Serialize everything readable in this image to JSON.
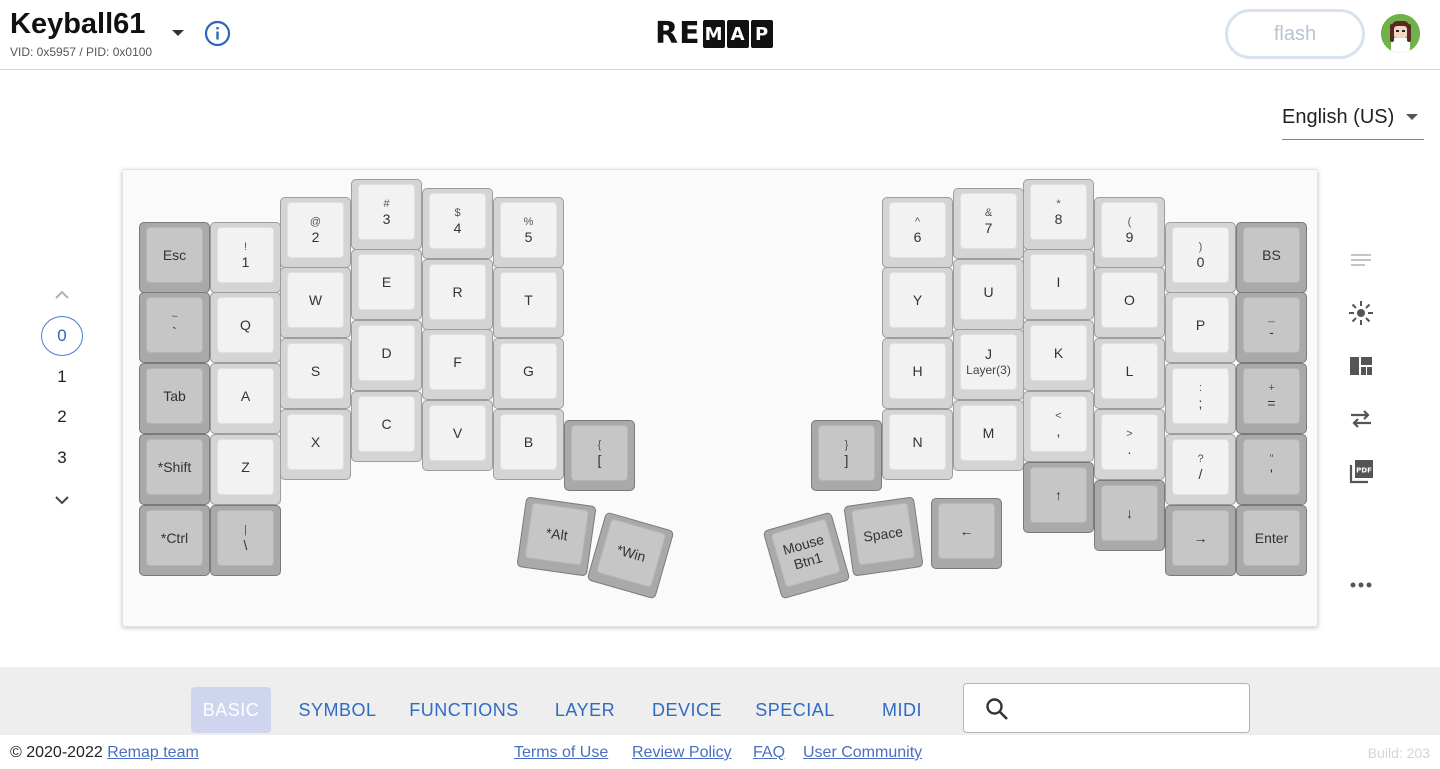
{
  "header": {
    "keyboard_name": "Keyball61",
    "ids": "VID: 0x5957 / PID: 0x0100",
    "logo_plain": "RE",
    "logo_boxed": [
      "M",
      "A",
      "P"
    ],
    "flash_label": "flash",
    "info_icon": "info-icon",
    "dropdown_icon": "caret-down-icon"
  },
  "language": {
    "selected": "English (US)"
  },
  "layers": {
    "items": [
      "0",
      "1",
      "2",
      "3"
    ],
    "active": "0"
  },
  "keys": [
    {
      "top": "",
      "main": "Esc",
      "sub": "",
      "tone": "dark"
    },
    {
      "top": "!",
      "main": "1",
      "sub": "",
      "tone": "light"
    },
    {
      "top": "@",
      "main": "2",
      "sub": "",
      "tone": "light"
    },
    {
      "top": "#",
      "main": "3",
      "sub": "",
      "tone": "light"
    },
    {
      "top": "$",
      "main": "4",
      "sub": "",
      "tone": "light"
    },
    {
      "top": "%",
      "main": "5",
      "sub": "",
      "tone": "light"
    },
    {
      "top": "~",
      "main": "`",
      "sub": "",
      "tone": "dark"
    },
    {
      "top": "",
      "main": "Q",
      "sub": "",
      "tone": "light"
    },
    {
      "top": "",
      "main": "W",
      "sub": "",
      "tone": "light"
    },
    {
      "top": "",
      "main": "E",
      "sub": "",
      "tone": "light"
    },
    {
      "top": "",
      "main": "R",
      "sub": "",
      "tone": "light"
    },
    {
      "top": "",
      "main": "T",
      "sub": "",
      "tone": "light"
    },
    {
      "top": "",
      "main": "Tab",
      "sub": "",
      "tone": "dark"
    },
    {
      "top": "",
      "main": "A",
      "sub": "",
      "tone": "light"
    },
    {
      "top": "",
      "main": "S",
      "sub": "",
      "tone": "light"
    },
    {
      "top": "",
      "main": "D",
      "sub": "",
      "tone": "light"
    },
    {
      "top": "",
      "main": "F",
      "sub": "",
      "tone": "light"
    },
    {
      "top": "",
      "main": "G",
      "sub": "",
      "tone": "light"
    },
    {
      "top": "",
      "main": "*Shift",
      "sub": "",
      "tone": "dark"
    },
    {
      "top": "",
      "main": "Z",
      "sub": "",
      "tone": "light"
    },
    {
      "top": "",
      "main": "X",
      "sub": "",
      "tone": "light"
    },
    {
      "top": "",
      "main": "C",
      "sub": "",
      "tone": "light"
    },
    {
      "top": "",
      "main": "V",
      "sub": "",
      "tone": "light"
    },
    {
      "top": "",
      "main": "B",
      "sub": "",
      "tone": "light"
    },
    {
      "top": "{",
      "main": "[",
      "sub": "",
      "tone": "dark"
    },
    {
      "top": "",
      "main": "*Ctrl",
      "sub": "",
      "tone": "dark"
    },
    {
      "top": "|",
      "main": "\\",
      "sub": "",
      "tone": "dark"
    },
    {
      "top": "",
      "main": "*Alt",
      "sub": "",
      "tone": "dark"
    },
    {
      "top": "",
      "main": "*Win",
      "sub": "",
      "tone": "dark"
    },
    {
      "top": "^",
      "main": "6",
      "sub": "",
      "tone": "light"
    },
    {
      "top": "&",
      "main": "7",
      "sub": "",
      "tone": "light"
    },
    {
      "top": "*",
      "main": "8",
      "sub": "",
      "tone": "light"
    },
    {
      "top": "(",
      "main": "9",
      "sub": "",
      "tone": "light"
    },
    {
      "top": ")",
      "main": "0",
      "sub": "",
      "tone": "light"
    },
    {
      "top": "",
      "main": "BS",
      "sub": "",
      "tone": "dark"
    },
    {
      "top": "",
      "main": "Y",
      "sub": "",
      "tone": "light"
    },
    {
      "top": "",
      "main": "U",
      "sub": "",
      "tone": "light"
    },
    {
      "top": "",
      "main": "I",
      "sub": "",
      "tone": "light"
    },
    {
      "top": "",
      "main": "O",
      "sub": "",
      "tone": "light"
    },
    {
      "top": "",
      "main": "P",
      "sub": "",
      "tone": "light"
    },
    {
      "top": "_",
      "main": "-",
      "sub": "",
      "tone": "dark"
    },
    {
      "top": "",
      "main": "H",
      "sub": "",
      "tone": "light"
    },
    {
      "top": "",
      "main": "J",
      "sub": "Layer(3)",
      "tone": "light"
    },
    {
      "top": "",
      "main": "K",
      "sub": "",
      "tone": "light"
    },
    {
      "top": "",
      "main": "L",
      "sub": "",
      "tone": "light"
    },
    {
      "top": ":",
      "main": ";",
      "sub": "",
      "tone": "light"
    },
    {
      "top": "+",
      "main": "=",
      "sub": "",
      "tone": "dark"
    },
    {
      "top": "}",
      "main": "]",
      "sub": "",
      "tone": "dark"
    },
    {
      "top": "",
      "main": "N",
      "sub": "",
      "tone": "light"
    },
    {
      "top": "",
      "main": "M",
      "sub": "",
      "tone": "light"
    },
    {
      "top": "<",
      "main": ",",
      "sub": "",
      "tone": "light"
    },
    {
      "top": ">",
      "main": ".",
      "sub": "",
      "tone": "light"
    },
    {
      "top": "?",
      "main": "/",
      "sub": "",
      "tone": "light"
    },
    {
      "top": "\"",
      "main": "'",
      "sub": "",
      "tone": "dark"
    },
    {
      "top": "",
      "main": "Mouse Btn1",
      "sub": "",
      "tone": "dark"
    },
    {
      "top": "",
      "main": "Space",
      "sub": "",
      "tone": "dark"
    },
    {
      "top": "",
      "main": "←",
      "sub": "",
      "tone": "dark"
    },
    {
      "top": "",
      "main": "↑",
      "sub": "",
      "tone": "dark"
    },
    {
      "top": "",
      "main": "↓",
      "sub": "",
      "tone": "dark"
    },
    {
      "top": "",
      "main": "→",
      "sub": "",
      "tone": "dark"
    },
    {
      "top": "",
      "main": "Enter",
      "sub": "",
      "tone": "dark"
    }
  ],
  "toolbar": {
    "icons": [
      "lines-icon",
      "lighting-icon",
      "layout-icon",
      "swap-icon",
      "pdf-icon",
      "more-icon"
    ]
  },
  "categories": {
    "tabs": [
      "BASIC",
      "SYMBOL",
      "FUNCTIONS",
      "LAYER",
      "DEVICE",
      "SPECIAL",
      "MIDI"
    ],
    "active": "BASIC"
  },
  "search": {
    "placeholder": "",
    "value": "",
    "icon": "search-icon"
  },
  "footer": {
    "copyright": "© 2020-2022",
    "team_link": "Remap team",
    "links": [
      "Terms of Use",
      "Review Policy",
      "FAQ",
      "User Community"
    ],
    "build": "Build: 203"
  },
  "colors": {
    "accent": "#2f6bc4",
    "active_tab_bg": "#cfd5ee",
    "key_light": "#f2f2f2",
    "key_dark": "#a9a9a9"
  }
}
